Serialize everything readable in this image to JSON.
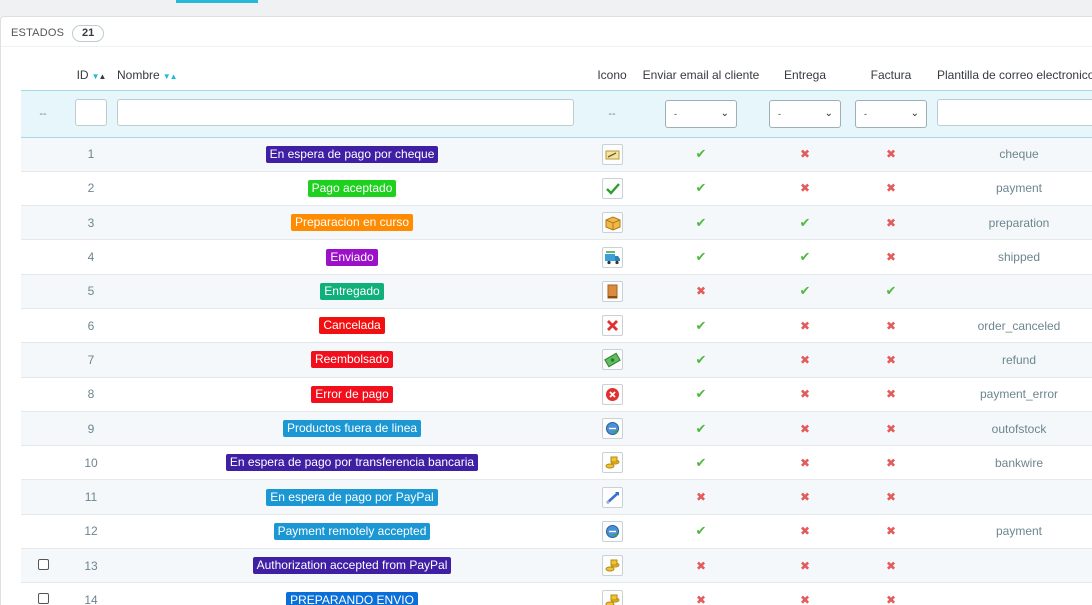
{
  "panel": {
    "title": "ESTADOS",
    "count": "21"
  },
  "columns": {
    "id": "ID",
    "name": "Nombre",
    "icon": "Icono",
    "email": "Enviar email al cliente",
    "delivery": "Entrega",
    "invoice": "Factura",
    "template": "Plantilla de correo electronico"
  },
  "filters": {
    "check_placeholder": "--",
    "icon_placeholder": "--",
    "select_value": "-"
  },
  "icons": {
    "check": "✔",
    "cross": "✖",
    "select_chevron": "⌄"
  },
  "colors": {
    "accent": "#25b9d7",
    "yes": "#50b93f",
    "no": "#e35b5b"
  },
  "rows": [
    {
      "id": "1",
      "name": "En espera de pago por cheque",
      "color": "#34209e",
      "icon": "cheque-icon",
      "email": true,
      "delivery": false,
      "invoice": false,
      "template": "cheque",
      "checkbox": false
    },
    {
      "id": "2",
      "name": "Pago aceptado",
      "color": "#32cd32",
      "icon": "payment-accepted-icon",
      "email": true,
      "delivery": false,
      "invoice": false,
      "template": "payment",
      "checkbox": false
    },
    {
      "id": "3",
      "name": "Preparacion en curso",
      "color": "#ff8c00",
      "icon": "package-icon",
      "email": true,
      "delivery": true,
      "invoice": false,
      "template": "preparation",
      "checkbox": false
    },
    {
      "id": "4",
      "name": "Enviado",
      "color": "#8a2be2",
      "icon": "shipped-icon",
      "email": true,
      "delivery": true,
      "invoice": false,
      "template": "shipped",
      "checkbox": false
    },
    {
      "id": "5",
      "name": "Entregado",
      "color": "#108510",
      "icon": "delivered-icon",
      "email": false,
      "delivery": true,
      "invoice": true,
      "template": "",
      "checkbox": false
    },
    {
      "id": "6",
      "name": "Cancelada",
      "color": "#dc143c",
      "icon": "cancelled-icon",
      "email": true,
      "delivery": false,
      "invoice": false,
      "template": "order_canceled",
      "checkbox": false
    },
    {
      "id": "7",
      "name": "Reembolsado",
      "color": "#ec2e15",
      "icon": "refund-icon",
      "email": true,
      "delivery": false,
      "invoice": false,
      "template": "refund",
      "checkbox": false
    },
    {
      "id": "8",
      "name": "Error de pago",
      "color": "#8f0621",
      "icon": "payment-error-icon",
      "email": true,
      "delivery": false,
      "invoice": false,
      "template": "payment_error",
      "checkbox": false
    },
    {
      "id": "9",
      "name": "Productos fuera de linea",
      "color": "#9dbd6f",
      "icon": "out-of-stock-icon",
      "email": true,
      "delivery": false,
      "invoice": false,
      "template": "outofstock",
      "checkbox": false
    },
    {
      "id": "10",
      "name": "En espera de pago por transferencia bancaria",
      "color": "#34209e",
      "icon": "bankwire-icon",
      "email": true,
      "delivery": false,
      "invoice": false,
      "template": "bankwire",
      "checkbox": false
    },
    {
      "id": "11",
      "name": "En espera de pago por PayPal",
      "color": "#4169e1",
      "icon": "paypal-pending-icon",
      "email": false,
      "delivery": false,
      "invoice": false,
      "template": "",
      "checkbox": false
    },
    {
      "id": "12",
      "name": "Payment remotely accepted",
      "color": "#32cd32",
      "icon": "remote-payment-icon",
      "email": true,
      "delivery": false,
      "invoice": false,
      "template": "payment",
      "checkbox": false
    },
    {
      "id": "13",
      "name": "Authorization accepted from PayPal",
      "color": "#34209e",
      "icon": "paypal-authorized-icon",
      "email": false,
      "delivery": false,
      "invoice": false,
      "template": "",
      "checkbox": true
    },
    {
      "id": "14",
      "name": "PREPARANDO ENVIO",
      "color": "#0055ff",
      "icon": "preparing-shipment-icon",
      "email": false,
      "delivery": false,
      "invoice": false,
      "template": "",
      "checkbox": true
    }
  ]
}
